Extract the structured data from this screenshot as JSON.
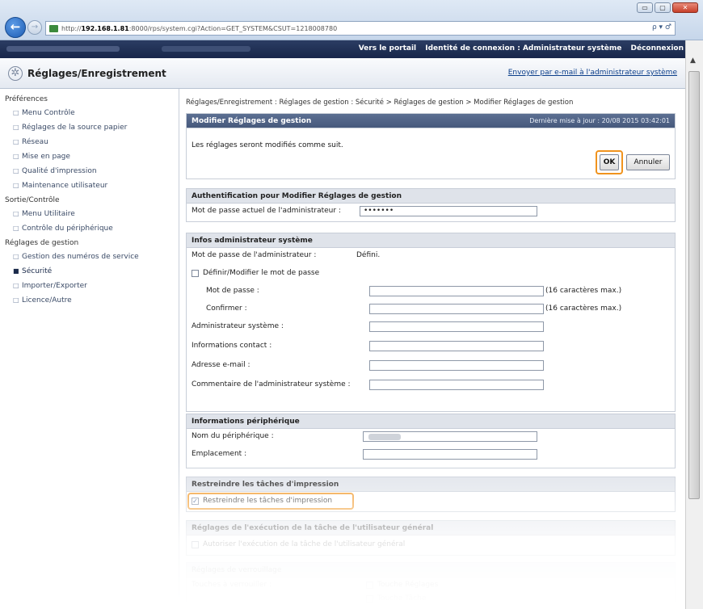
{
  "browser": {
    "url_prefix": "http://",
    "url_host": "192.168.1.81",
    "url_rest": ":8000/rps/system.cgi?Action=GET_SYSTEM&CSUT=1218008780",
    "addr_tools": "ρ ▾ ♂",
    "tool_icons": "⌂ ☆ ⚙",
    "window_buttons": [
      "▭",
      "▢",
      "✕"
    ]
  },
  "topbar": {
    "links": [
      "Vers le portail",
      "Identité de connexion : Administrateur système",
      "Déconnexion"
    ]
  },
  "header": {
    "title": "Réglages/Enregistrement",
    "mail_link": "Envoyer par e-mail à l'administrateur système"
  },
  "sidebar": {
    "groups": [
      {
        "label": "Préférences",
        "items": [
          "Menu Contrôle",
          "Réglages de la source papier",
          "Réseau",
          "Mise en page",
          "Qualité d'impression",
          "Maintenance utilisateur"
        ]
      },
      {
        "label": "Sortie/Contrôle",
        "items": [
          "Menu Utilitaire",
          "Contrôle du périphérique"
        ]
      },
      {
        "label": "Réglages de gestion",
        "items": [
          "Gestion des numéros de service",
          "Sécurité",
          "Importer/Exporter",
          "Licence/Autre"
        ]
      }
    ],
    "bullet": "□",
    "active_bullet": "■"
  },
  "breadcrumb": "Réglages/Enregistrement : Réglages de gestion : Sécurité > Réglages de gestion > Modifier Réglages de gestion",
  "modify": {
    "title": "Modifier Réglages de gestion",
    "last_update": "Dernière mise à jour : 20/08 2015 03:42:01",
    "message": "Les réglages seront modifiés comme suit.",
    "ok_label": "OK",
    "cancel_label": "Annuler"
  },
  "auth": {
    "title": "Authentification pour Modifier Réglages de gestion",
    "current_pw_label": "Mot de passe actuel de l'administrateur :",
    "current_pw_value": "•••••••"
  },
  "admin_info": {
    "title": "Infos administrateur système",
    "pw_label": "Mot de passe de l'administrateur :",
    "pw_status": "Défini.",
    "set_change_label": "Définir/Modifier le mot de passe",
    "password_label": "Mot de passe :",
    "confirm_label": "Confirmer :",
    "max_hint": "(16 caractères max.)",
    "sysadmin_label": "Administrateur système :",
    "contact_label": "Informations contact :",
    "email_label": "Adresse e-mail :",
    "comment_label": "Commentaire de l'administrateur système :"
  },
  "device_info": {
    "title": "Informations périphérique",
    "name_label": "Nom du périphérique :",
    "location_label": "Emplacement :"
  },
  "restrict": {
    "title": "Restreindre les tâches d'impression",
    "checkbox_label": "Restreindre les tâches d'impression",
    "checked": "✓"
  },
  "general_user": {
    "title": "Réglages de l'exécution de la tâche de l'utilisateur général",
    "checkbox_label": "Autoriser l'exécution de la tâche de l'utilisateur général"
  },
  "lock": {
    "title": "Réglages de verrouillage",
    "keys_label": "Touches à verrouiller :",
    "key1": "Touche Réglages",
    "key2": "Touche Tâche"
  },
  "icons": {
    "back": "back-arrow-icon",
    "forward": "forward-arrow-icon",
    "gear": "gear-icon",
    "favicon": "site-favicon-icon"
  }
}
